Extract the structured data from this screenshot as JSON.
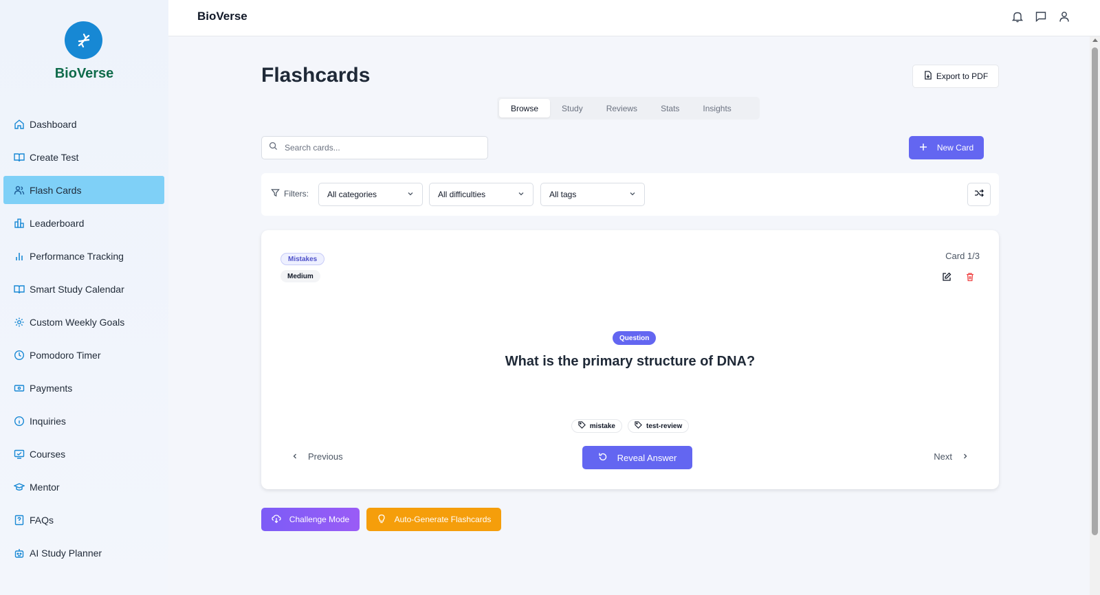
{
  "brand": {
    "name": "BioVerse"
  },
  "sidebar": {
    "items": [
      {
        "label": "Dashboard",
        "icon": "home-icon"
      },
      {
        "label": "Create Test",
        "icon": "book-icon"
      },
      {
        "label": "Flash Cards",
        "icon": "users-icon",
        "active": true
      },
      {
        "label": "Leaderboard",
        "icon": "building-icon"
      },
      {
        "label": "Performance Tracking",
        "icon": "bar-chart-icon"
      },
      {
        "label": "Smart Study Calendar",
        "icon": "book-icon"
      },
      {
        "label": "Custom Weekly Goals",
        "icon": "gear-icon"
      },
      {
        "label": "Pomodoro Timer",
        "icon": "clock-icon"
      },
      {
        "label": "Payments",
        "icon": "payment-icon"
      },
      {
        "label": "Inquiries",
        "icon": "info-icon"
      },
      {
        "label": "Courses",
        "icon": "monitor-icon"
      },
      {
        "label": "Mentor",
        "icon": "graduation-cap-icon"
      },
      {
        "label": "FAQs",
        "icon": "question-file-icon"
      },
      {
        "label": "AI Study Planner",
        "icon": "robot-icon"
      }
    ]
  },
  "topbar": {
    "title": "BioVerse"
  },
  "main": {
    "title": "Flashcards",
    "export_label": "Export to PDF",
    "tabs": [
      {
        "label": "Browse",
        "active": true
      },
      {
        "label": "Study"
      },
      {
        "label": "Reviews"
      },
      {
        "label": "Stats"
      },
      {
        "label": "Insights"
      }
    ],
    "search_placeholder": "Search cards...",
    "new_card_label": "New Card",
    "filters": {
      "label": "Filters:",
      "category": "All categories",
      "difficulty": "All difficulties",
      "tags": "All tags"
    },
    "card": {
      "category_badge": "Mistakes",
      "difficulty_badge": "Medium",
      "counter": "Card 1/3",
      "side_badge": "Question",
      "question": "What is the primary structure of DNA?",
      "tags": [
        "mistake",
        "test-review"
      ],
      "prev_label": "Previous",
      "reveal_label": "Reveal Answer",
      "next_label": "Next"
    },
    "challenge_label": "Challenge Mode",
    "autogen_label": "Auto-Generate Flashcards"
  },
  "colors": {
    "accent": "#6366f1",
    "active_nav": "#7fd0f7",
    "brand_green": "#0f6b4a",
    "logo_blue": "#1788d4",
    "warning": "#f59e0b",
    "danger": "#ef4444"
  }
}
